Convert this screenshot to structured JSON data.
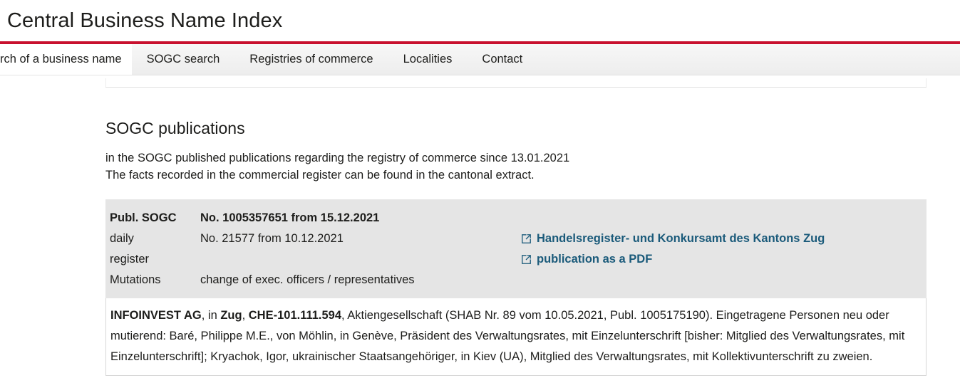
{
  "header": {
    "title": "Central Business Name Index",
    "accent_color": "#c8102e"
  },
  "nav": {
    "tabs": [
      {
        "label": "rch of a business name",
        "active": true
      },
      {
        "label": "SOGC search",
        "active": false
      },
      {
        "label": "Registries of commerce",
        "active": false
      },
      {
        "label": "Localities",
        "active": false
      },
      {
        "label": "Contact",
        "active": false
      }
    ]
  },
  "main": {
    "section_title": "SOGC publications",
    "intro_line_1": "in the SOGC published publications regarding the registry of commerce since 13.01.2021",
    "intro_line_2": "The facts recorded in the commercial register can be found in the cantonal extract.",
    "publication": {
      "rows": [
        {
          "label": "Publ. SOGC",
          "label_bold": true,
          "value": "No. 1005357651 from 15.12.2021",
          "value_bold": true
        },
        {
          "label": "daily",
          "label_bold": false,
          "value": "No. 21577 from 10.12.2021",
          "value_bold": false
        },
        {
          "label": "register",
          "label_bold": false,
          "value": "",
          "value_bold": false
        },
        {
          "label": "Mutations",
          "label_bold": false,
          "value": "change of exec. officers / representatives",
          "value_bold": false
        }
      ],
      "links": [
        {
          "label": "Handelsregister- und Konkursamt des Kantons Zug",
          "icon": "external-link-icon"
        },
        {
          "label": "publication as a PDF",
          "icon": "external-link-icon"
        }
      ],
      "link_color": "#1a5a7a",
      "body_company": "INFOINVEST AG",
      "body_sep_1": ", in ",
      "body_city": "Zug",
      "body_sep_2": ", ",
      "body_uid": "CHE-101.111.594",
      "body_rest": ", Aktiengesellschaft (SHAB Nr. 89 vom 10.05.2021, Publ. 1005175190). Eingetragene Personen neu oder mutierend: Baré, Philippe M.E., von Möhlin, in Genève, Präsident des Verwaltungsrates, mit Einzelunterschrift [bisher: Mitglied des Verwaltungsrates, mit Einzelunterschrift]; Kryachok, Igor, ukrainischer Staatsangehöriger, in Kiev (UA), Mitglied des Verwaltungsrates, mit Kollektivunterschrift zu zweien."
    }
  }
}
